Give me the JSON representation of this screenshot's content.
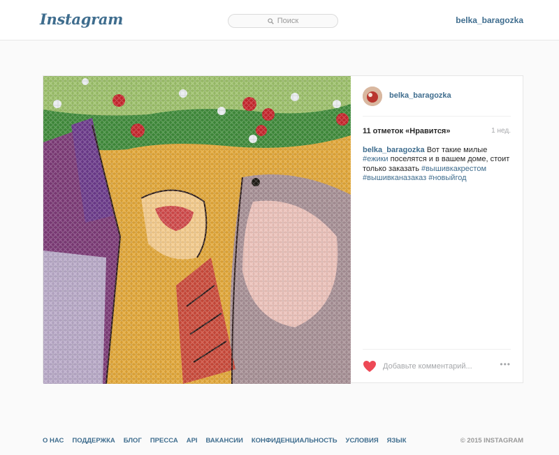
{
  "header": {
    "logo": "Instagram",
    "search_placeholder": "Поиск",
    "username": "belka_baragozka"
  },
  "post": {
    "owner": "belka_baragozka",
    "likes": "11 отметок «Нравится»",
    "age": "1 нед.",
    "caption": {
      "author": "belka_baragozka",
      "text_1": " Вот такие милые ",
      "tag_1": "#ежики",
      "text_2": " поселятся и в вашем доме, стоит только заказать ",
      "tag_2": "#вышивкакрестом",
      "tag_3": "#вышивканазаказ",
      "tag_4": "#новыйгод"
    },
    "comment_placeholder": "Добавьте комментарий...",
    "more_glyph": "•••"
  },
  "footer": {
    "links": [
      "О НАС",
      "ПОДДЕРЖКА",
      "БЛОГ",
      "ПРЕССА",
      "API",
      "ВАКАНСИИ",
      "КОНФИДЕНЦИАЛЬНОСТЬ",
      "УСЛОВИЯ",
      "ЯЗЫК"
    ],
    "copyright": "© 2015 INSTAGRAM"
  },
  "colors": {
    "link": "#3f6d8e",
    "heart": "#ed4956",
    "background": "#fafafa"
  }
}
